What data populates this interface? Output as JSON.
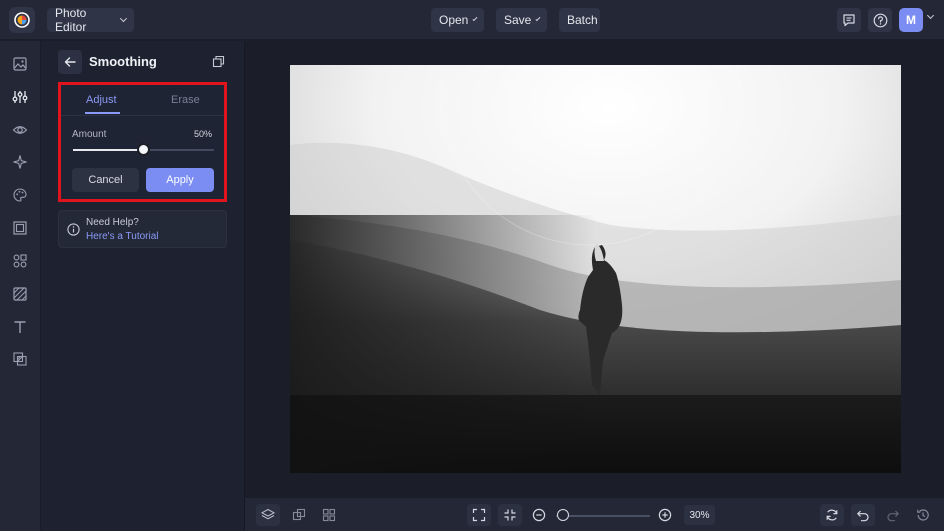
{
  "topbar": {
    "app_menu_label": "Photo Editor",
    "open_label": "Open",
    "save_label": "Save",
    "batch_label": "Batch",
    "avatar_initial": "M"
  },
  "sidebar": {
    "icons": [
      "image-icon",
      "adjustments-icon",
      "eye-icon",
      "sparkle-icon",
      "palette-icon",
      "frame-icon",
      "elements-icon",
      "texture-icon",
      "text-icon",
      "overlay-icon"
    ],
    "active_index": 1
  },
  "panel": {
    "title": "Smoothing",
    "tabs": [
      {
        "label": "Adjust",
        "active": true
      },
      {
        "label": "Erase",
        "active": false
      }
    ],
    "amount_label": "Amount",
    "amount_value": "50%",
    "amount_fraction": 0.5,
    "cancel_label": "Cancel",
    "apply_label": "Apply",
    "help_title": "Need Help?",
    "help_link": "Here's a Tutorial"
  },
  "bottombar": {
    "zoom_value": "30%",
    "zoom_fraction": 0.05
  },
  "colors": {
    "accent": "#7b8cf3",
    "highlight_border": "#e0141c",
    "background": "#1b1e28",
    "panel": "#1e2230"
  }
}
